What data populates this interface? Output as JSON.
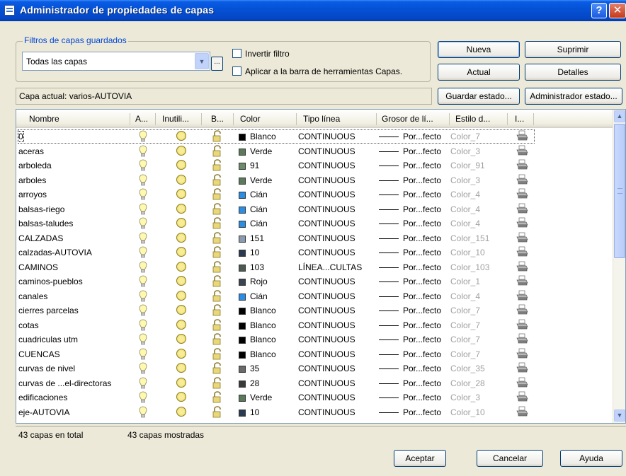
{
  "window": {
    "title": "Administrador de propiedades de capas"
  },
  "filters": {
    "group_label": "Filtros de capas guardados",
    "selected": "Todas las capas",
    "invert_label": "Invertir filtro",
    "apply_toolbar_label": "Aplicar a la barra de herramientas Capas."
  },
  "buttons": {
    "new": "Nueva",
    "delete": "Suprimir",
    "current": "Actual",
    "details": "Detalles",
    "save_state": "Guardar estado...",
    "state_manager": "Administrador estado...",
    "ok": "Aceptar",
    "cancel": "Cancelar",
    "help": "Ayuda",
    "ellipsis": "..."
  },
  "current_layer": "Capa actual:  varios-AUTOVIA",
  "columns": [
    "Nombre",
    "A...",
    "Inutili...",
    "B...",
    "Color",
    "Tipo línea",
    "Grosor de lí...",
    "Estilo d...",
    "I..."
  ],
  "layers": [
    {
      "name": "0",
      "color": "#000000",
      "color_name": "Blanco",
      "linetype": "CONTINUOUS",
      "lineweight": "Por...fecto",
      "plot_style": "Color_7"
    },
    {
      "name": "aceras",
      "color": "#5a7a5a",
      "color_name": "Verde",
      "linetype": "CONTINUOUS",
      "lineweight": "Por...fecto",
      "plot_style": "Color_3"
    },
    {
      "name": "arboleda",
      "color": "#6b8c6b",
      "color_name": "91",
      "linetype": "CONTINUOUS",
      "lineweight": "Por...fecto",
      "plot_style": "Color_91"
    },
    {
      "name": "arboles",
      "color": "#5a7a5a",
      "color_name": "Verde",
      "linetype": "CONTINUOUS",
      "lineweight": "Por...fecto",
      "plot_style": "Color_3"
    },
    {
      "name": "arroyos",
      "color": "#2b8ee6",
      "color_name": "Cián",
      "linetype": "CONTINUOUS",
      "lineweight": "Por...fecto",
      "plot_style": "Color_4"
    },
    {
      "name": "balsas-riego",
      "color": "#2b8ee6",
      "color_name": "Cián",
      "linetype": "CONTINUOUS",
      "lineweight": "Por...fecto",
      "plot_style": "Color_4"
    },
    {
      "name": "balsas-taludes",
      "color": "#2b8ee6",
      "color_name": "Cián",
      "linetype": "CONTINUOUS",
      "lineweight": "Por...fecto",
      "plot_style": "Color_4"
    },
    {
      "name": "CALZADAS",
      "color": "#8a9ab0",
      "color_name": "151",
      "linetype": "CONTINUOUS",
      "lineweight": "Por...fecto",
      "plot_style": "Color_151"
    },
    {
      "name": "calzadas-AUTOVIA",
      "color": "#2a3a52",
      "color_name": "10",
      "linetype": "CONTINUOUS",
      "lineweight": "Por...fecto",
      "plot_style": "Color_10"
    },
    {
      "name": "CAMINOS",
      "color": "#4a5a52",
      "color_name": "103",
      "linetype": "LÍNEA...CULTAS",
      "lineweight": "Por...fecto",
      "plot_style": "Color_103"
    },
    {
      "name": "caminos-pueblos",
      "color": "#3a4452",
      "color_name": "Rojo",
      "linetype": "CONTINUOUS",
      "lineweight": "Por...fecto",
      "plot_style": "Color_1"
    },
    {
      "name": "canales",
      "color": "#2b8ee6",
      "color_name": "Cián",
      "linetype": "CONTINUOUS",
      "lineweight": "Por...fecto",
      "plot_style": "Color_4"
    },
    {
      "name": "cierres parcelas",
      "color": "#000000",
      "color_name": "Blanco",
      "linetype": "CONTINUOUS",
      "lineweight": "Por...fecto",
      "plot_style": "Color_7"
    },
    {
      "name": "cotas",
      "color": "#000000",
      "color_name": "Blanco",
      "linetype": "CONTINUOUS",
      "lineweight": "Por...fecto",
      "plot_style": "Color_7"
    },
    {
      "name": "cuadriculas utm",
      "color": "#000000",
      "color_name": "Blanco",
      "linetype": "CONTINUOUS",
      "lineweight": "Por...fecto",
      "plot_style": "Color_7"
    },
    {
      "name": "CUENCAS",
      "color": "#000000",
      "color_name": "Blanco",
      "linetype": "CONTINUOUS",
      "lineweight": "Por...fecto",
      "plot_style": "Color_7"
    },
    {
      "name": "curvas de nivel",
      "color": "#6a6a6a",
      "color_name": "35",
      "linetype": "CONTINUOUS",
      "lineweight": "Por...fecto",
      "plot_style": "Color_35"
    },
    {
      "name": "curvas de ...el-directoras",
      "color": "#3a3a3a",
      "color_name": "28",
      "linetype": "CONTINUOUS",
      "lineweight": "Por...fecto",
      "plot_style": "Color_28"
    },
    {
      "name": "edificaciones",
      "color": "#5a7a5a",
      "color_name": "Verde",
      "linetype": "CONTINUOUS",
      "lineweight": "Por...fecto",
      "plot_style": "Color_3"
    },
    {
      "name": "eje-AUTOVIA",
      "color": "#2a3a52",
      "color_name": "10",
      "linetype": "CONTINUOUS",
      "lineweight": "Por...fecto",
      "plot_style": "Color_10"
    }
  ],
  "status": {
    "total": "43 capas en total",
    "shown": "43 capas mostradas"
  }
}
